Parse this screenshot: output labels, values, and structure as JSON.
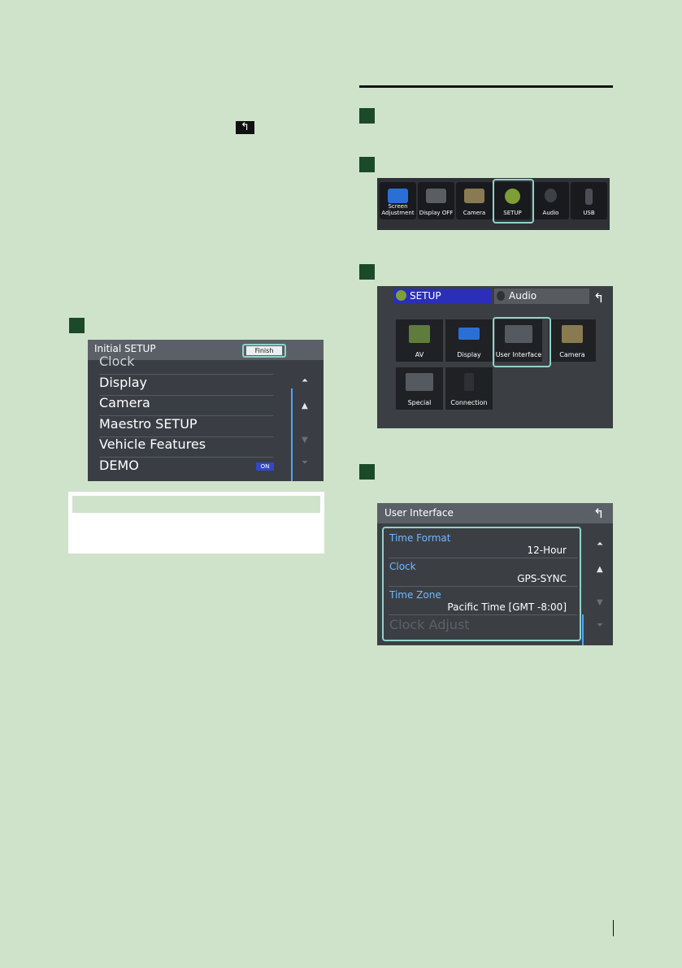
{
  "back_glyph": "↰",
  "initial_setup": {
    "title": "Initial SETUP",
    "finish_button": "Finish",
    "items": [
      "Clock",
      "Display",
      "Camera",
      "Maestro SETUP",
      "Vehicle Features",
      "DEMO"
    ],
    "demo_badge": "ON"
  },
  "home_bar": {
    "tiles": [
      "Screen Adjustment",
      "Display OFF",
      "Camera",
      "SETUP",
      "Audio",
      "USB"
    ],
    "selected": "SETUP"
  },
  "setup_menu": {
    "tab_setup": "SETUP",
    "tab_audio": "Audio",
    "tiles": [
      "AV",
      "Display",
      "User Interface",
      "Camera",
      "Special",
      "Connection"
    ],
    "selected": "User Interface"
  },
  "user_interface": {
    "title": "User Interface",
    "items": [
      {
        "label": "Time Format",
        "value": "12-Hour"
      },
      {
        "label": "Clock",
        "value": "GPS-SYNC"
      },
      {
        "label": "Time Zone",
        "value": "Pacific Time [GMT -8:00]"
      }
    ],
    "faded_item": "Clock Adjust"
  },
  "colors": {
    "page_bg": "#cfe3cb",
    "step_box": "#1b4a2a",
    "highlight": "#8fd3c8",
    "ui_label": "#6fb9ff"
  }
}
